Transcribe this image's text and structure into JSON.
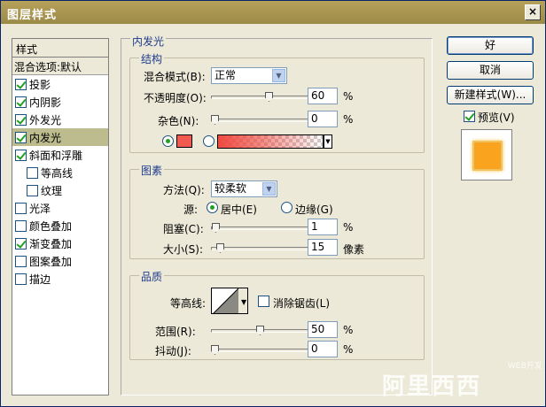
{
  "window": {
    "title": "图层样式",
    "close": "×"
  },
  "left_panel": {
    "header": "样式",
    "blend_item": "混合选项:默认",
    "items": [
      {
        "label": "投影",
        "checked": true
      },
      {
        "label": "内阴影",
        "checked": true
      },
      {
        "label": "外发光",
        "checked": true
      },
      {
        "label": "内发光",
        "checked": true,
        "selected": true
      },
      {
        "label": "斜面和浮雕",
        "checked": true
      },
      {
        "label": "等高线",
        "checked": false,
        "sub": true
      },
      {
        "label": "纹理",
        "checked": false,
        "sub": true
      },
      {
        "label": "光泽",
        "checked": false
      },
      {
        "label": "颜色叠加",
        "checked": false
      },
      {
        "label": "渐变叠加",
        "checked": true
      },
      {
        "label": "图案叠加",
        "checked": false
      },
      {
        "label": "描边",
        "checked": false
      }
    ]
  },
  "inner_glow": {
    "title": "内发光",
    "structure": {
      "title": "结构",
      "blend_mode_label": "混合模式(B):",
      "blend_mode_value": "正常",
      "opacity_label": "不透明度(O):",
      "opacity_value": "60",
      "noise_label": "杂色(N):",
      "noise_value": "0",
      "percent": "%",
      "opacity_fraction": 0.6,
      "noise_fraction": 0.0,
      "color_mode": "solid",
      "color": "#f05a50"
    },
    "elements": {
      "title": "图素",
      "technique_label": "方法(Q):",
      "technique_value": "较柔软",
      "source_label": "源:",
      "source_center": "居中(E)",
      "source_edge": "边缘(G)",
      "source_selected": "center",
      "choke_label": "阻塞(C):",
      "choke_value": "1",
      "choke_unit": "%",
      "size_label": "大小(S):",
      "size_value": "15",
      "size_unit": "像素",
      "choke_fraction": 0.01,
      "size_fraction": 0.06
    },
    "quality": {
      "title": "品质",
      "contour_label": "等高线:",
      "antialias_label": "消除锯齿(L)",
      "antialias_checked": false,
      "range_label": "范围(R):",
      "range_value": "50",
      "range_unit": "%",
      "jitter_label": "抖动(J):",
      "jitter_value": "0",
      "jitter_unit": "%",
      "range_fraction": 0.5,
      "jitter_fraction": 0.0
    }
  },
  "buttons": {
    "ok": "好",
    "cancel": "取消",
    "new_style": "新建样式(W)..."
  },
  "preview": {
    "label": "预览(V)",
    "checked": true,
    "swatch_color": "#f9a31e"
  },
  "watermark": {
    "text": "阿里西西",
    "small": "WEB开发"
  }
}
